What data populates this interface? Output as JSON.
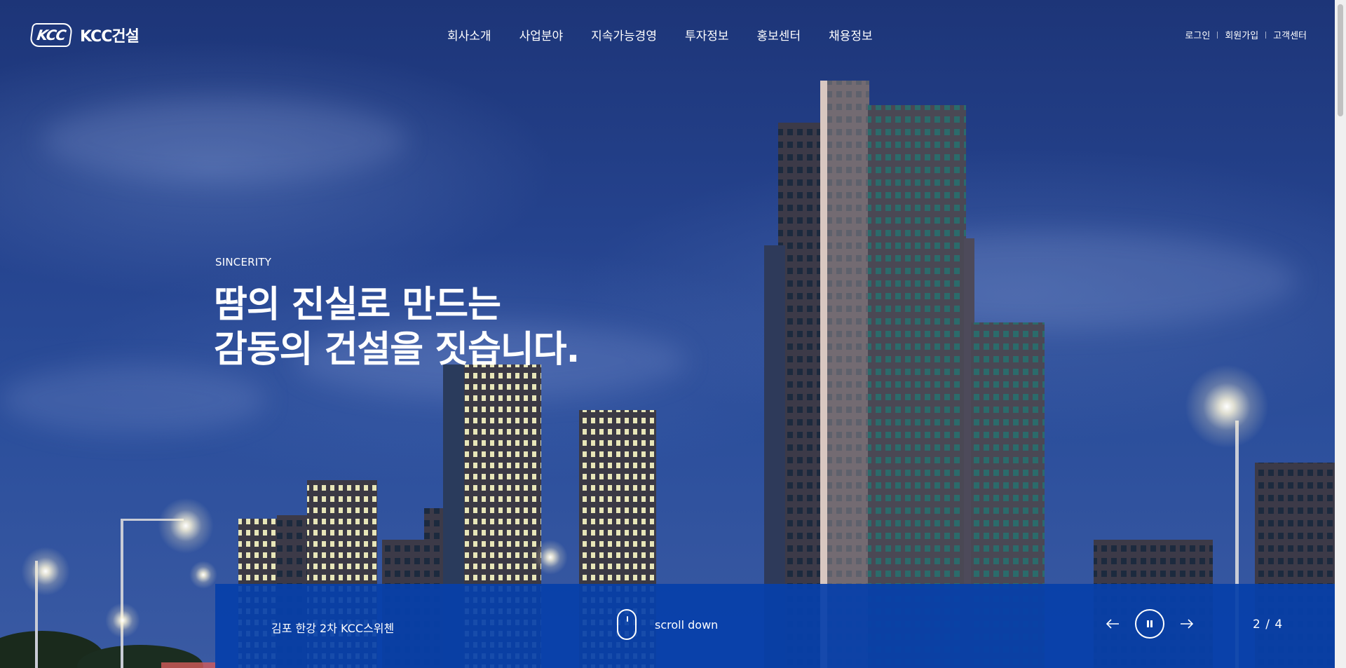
{
  "brand": {
    "mark": "KCC",
    "name": "KCC건설"
  },
  "nav": {
    "items": [
      "회사소개",
      "사업분야",
      "지속가능경영",
      "투자정보",
      "홍보센터",
      "채용정보"
    ]
  },
  "util": {
    "login": "로그인",
    "signup": "회원가입",
    "support": "고객센터"
  },
  "hero": {
    "eyebrow": "SINCERITY",
    "headline_line1": "땀의 진실로 만드는",
    "headline_line2": "감동의 건설을 짓습니다."
  },
  "bar": {
    "caption": "김포 한강 2차 KCC스위첸",
    "scroll_label": "scroll down",
    "counter": "2 / 4"
  },
  "colors": {
    "bar": "#0640aa",
    "sky": "#25438e"
  }
}
